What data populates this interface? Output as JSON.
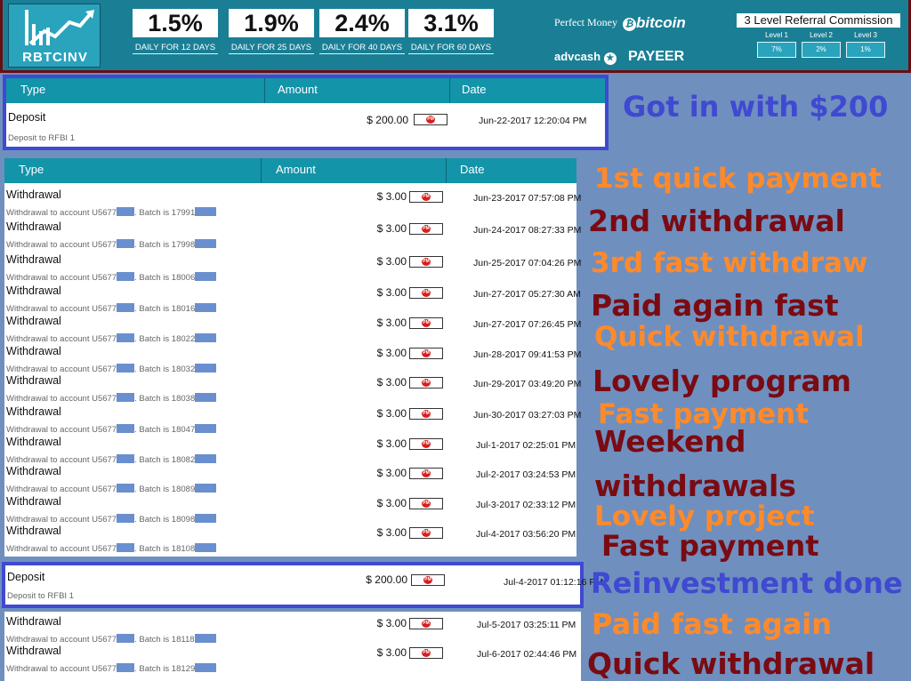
{
  "header": {
    "logo_text": "RBTCINV",
    "rates": [
      {
        "pct": "1.5%",
        "label": "DAILY FOR 12 DAYS"
      },
      {
        "pct": "1.9%",
        "label": "DAILY FOR 25 DAYS"
      },
      {
        "pct": "2.4%",
        "label": "DAILY FOR 40 DAYS"
      },
      {
        "pct": "3.1%",
        "label": "DAILY FOR 60 DAYS"
      }
    ],
    "payments": {
      "perfect_money": "Perfect Money",
      "bitcoin": "bitcoin",
      "advcash": "advcash",
      "payeer": "PAYEER"
    },
    "referral": {
      "title": "3 Level Referral Commission",
      "levels": [
        {
          "name": "Level 1",
          "value": "7%"
        },
        {
          "name": "Level 2",
          "value": "2%"
        },
        {
          "name": "Level 3",
          "value": "1%"
        }
      ]
    }
  },
  "columns": {
    "type": "Type",
    "amount": "Amount",
    "date": "Date"
  },
  "deposit_table": {
    "rows": [
      {
        "type": "Deposit",
        "desc": "Deposit to RFBI 1",
        "amount": "$ 200.00",
        "pm": "PM",
        "date": "Jun-22-2017 12:20:04 PM"
      }
    ]
  },
  "withdrawals_table": {
    "rows": [
      {
        "type": "Withdrawal",
        "desc_prefix": "Withdrawal to account U5677",
        "desc_mid": ". Batch is 17991",
        "amount": "$ 3.00",
        "pm": "PM",
        "date": "Jun-23-2017 07:57:08 PM"
      },
      {
        "type": "Withdrawal",
        "desc_prefix": "Withdrawal to account U5677",
        "desc_mid": ". Batch is 17998",
        "amount": "$ 3.00",
        "pm": "PM",
        "date": "Jun-24-2017 08:27:33 PM"
      },
      {
        "type": "Withdrawal",
        "desc_prefix": "Withdrawal to account U5677",
        "desc_mid": ". Batch is 18006",
        "amount": "$ 3.00",
        "pm": "PM",
        "date": "Jun-25-2017 07:04:26 PM"
      },
      {
        "type": "Withdrawal",
        "desc_prefix": "Withdrawal to account U5677",
        "desc_mid": ". Batch is 18016",
        "amount": "$ 3.00",
        "pm": "PM",
        "date": "Jun-27-2017 05:27:30 AM"
      },
      {
        "type": "Withdrawal",
        "desc_prefix": "Withdrawal to account U5677",
        "desc_mid": ". Batch is 18022",
        "amount": "$ 3.00",
        "pm": "PM",
        "date": "Jun-27-2017 07:26:45 PM"
      },
      {
        "type": "Withdrawal",
        "desc_prefix": "Withdrawal to account U5677",
        "desc_mid": ". Batch is 18032",
        "amount": "$ 3.00",
        "pm": "PM",
        "date": "Jun-28-2017 09:41:53 PM"
      },
      {
        "type": "Withdrawal",
        "desc_prefix": "Withdrawal to account U5677",
        "desc_mid": ". Batch is 18038",
        "amount": "$ 3.00",
        "pm": "PM",
        "date": "Jun-29-2017 03:49:20 PM"
      },
      {
        "type": "Withdrawal",
        "desc_prefix": "Withdrawal to account U5677",
        "desc_mid": ". Batch is 18047",
        "amount": "$ 3.00",
        "pm": "PM",
        "date": "Jun-30-2017 03:27:03 PM"
      },
      {
        "type": "Withdrawal",
        "desc_prefix": "Withdrawal to account U5677",
        "desc_mid": ". Batch is 18082",
        "amount": "$ 3.00",
        "pm": "PM",
        "date": "Jul-1-2017 02:25:01 PM"
      },
      {
        "type": "Withdrawal",
        "desc_prefix": "Withdrawal to account U5677",
        "desc_mid": ". Batch is 18089",
        "amount": "$ 3.00",
        "pm": "PM",
        "date": "Jul-2-2017 03:24:53 PM"
      },
      {
        "type": "Withdrawal",
        "desc_prefix": "Withdrawal to account U5677",
        "desc_mid": ". Batch is 18098",
        "amount": "$ 3.00",
        "pm": "PM",
        "date": "Jul-3-2017 02:33:12 PM"
      },
      {
        "type": "Withdrawal",
        "desc_prefix": "Withdrawal to account U5677",
        "desc_mid": ". Batch is 18108",
        "amount": "$ 3.00",
        "pm": "PM",
        "date": "Jul-4-2017 03:56:20 PM"
      }
    ]
  },
  "reinvest_table": {
    "rows": [
      {
        "type": "Deposit",
        "desc": "Deposit to RFBI 1",
        "amount": "$ 200.00",
        "pm": "PM",
        "date": "Jul-4-2017 01:12:16 PM"
      }
    ]
  },
  "recent_table": {
    "rows": [
      {
        "type": "Withdrawal",
        "desc_prefix": "Withdrawal to account U5677",
        "desc_mid": ". Batch is 18118",
        "amount": "$ 3.00",
        "pm": "PM",
        "date": "Jul-5-2017 03:25:11 PM"
      },
      {
        "type": "Withdrawal",
        "desc_prefix": "Withdrawal to account U5677",
        "desc_mid": ". Batch is 18129",
        "amount": "$ 3.00",
        "pm": "PM",
        "date": "Jul-6-2017 02:44:46 PM"
      }
    ]
  },
  "captions": [
    {
      "text": "Got in with $200",
      "color": "blue"
    },
    {
      "text": "1st quick payment",
      "color": "orange"
    },
    {
      "text": "2nd withdrawal",
      "color": "dark"
    },
    {
      "text": "3rd fast withdraw",
      "color": "orange"
    },
    {
      "text": "Paid again fast",
      "color": "dark"
    },
    {
      "text": "Quick withdrawal",
      "color": "orange"
    },
    {
      "text": "Lovely program",
      "color": "dark"
    },
    {
      "text": "Fast payment",
      "color": "orange"
    },
    {
      "text": "Weekend",
      "color": "dark"
    },
    {
      "text": "withdrawals",
      "color": "dark"
    },
    {
      "text": "Lovely project",
      "color": "orange"
    },
    {
      "text": "Fast payment",
      "color": "dark"
    },
    {
      "text": "Reinvestment done",
      "color": "blue"
    },
    {
      "text": "Paid fast again",
      "color": "orange"
    },
    {
      "text": "Quick withdrawal",
      "color": "dark"
    }
  ],
  "colors": {
    "header_bg": "#1a7f95",
    "table_header": "#1394a9",
    "page_bg": "#6f8fbf",
    "highlight_border": "#3f49d1",
    "caption_blue": "#3f49d1",
    "caption_orange": "#ff8a2a",
    "caption_dark": "#7a0b12",
    "pm_red": "#d81e1e"
  }
}
